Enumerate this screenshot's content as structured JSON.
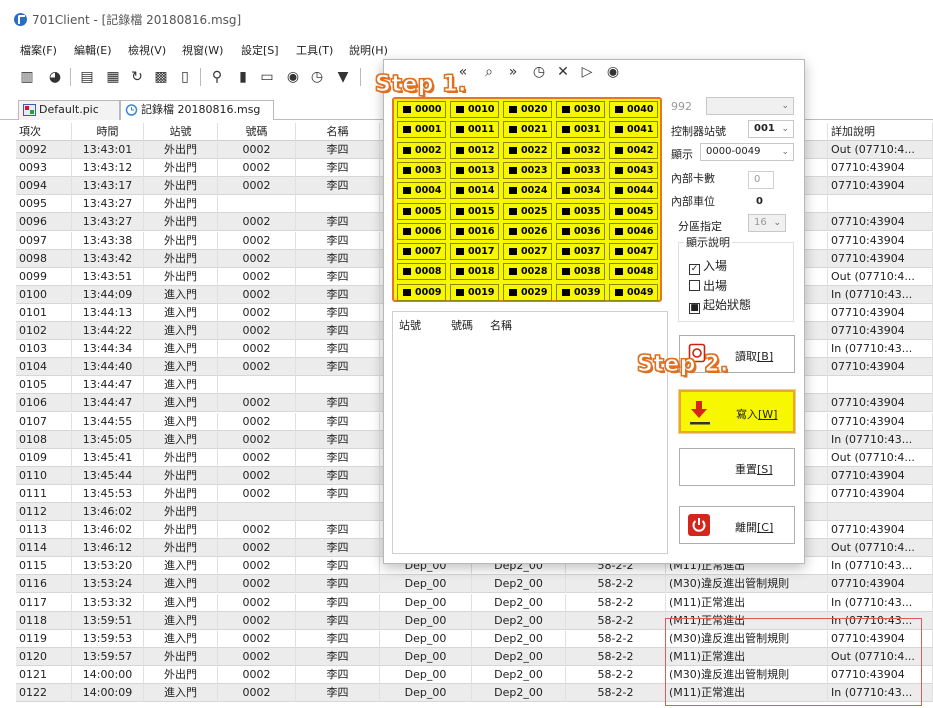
{
  "window": {
    "title": "701Client - [記錄檔 20180816.msg]"
  },
  "menu": [
    "檔案(F)",
    "編輯(E)",
    "檢視(V)",
    "視窗(W)",
    "設定[S]",
    "工具(T)",
    "說明(H)"
  ],
  "toolbar": {
    "icons": [
      "print-icon",
      "preview-icon",
      "edit-icon",
      "calendar-icon",
      "refresh-icon",
      "database-icon",
      "chart-icon",
      "users-icon",
      "card-icon",
      "archive-icon",
      "lock-icon",
      "clock-icon",
      "filter-icon"
    ],
    "dialog_icons": [
      "first-icon",
      "prev-icon",
      "search-icon",
      "next-icon",
      "history-icon",
      "pin-icon",
      "play-icon",
      "stop-icon"
    ],
    "dialog_glyphs": [
      "«",
      "⌕",
      "»",
      "◷",
      "✕",
      "▷",
      "◉"
    ]
  },
  "tabs": [
    {
      "label": "Default.pic"
    },
    {
      "label": "記錄檔 20180816.msg"
    }
  ],
  "grid": {
    "headers": [
      "項次",
      "時間",
      "站號",
      "號碼",
      "名稱",
      "",
      "",
      "",
      "",
      "詳加說明"
    ],
    "rows": [
      [
        "0092",
        "13:43:01",
        "外出門",
        "0002",
        "李四",
        "",
        "",
        "",
        "",
        "Out (07710:4..."
      ],
      [
        "0093",
        "13:43:12",
        "外出門",
        "0002",
        "李四",
        "",
        "",
        "",
        "",
        "07710:43904"
      ],
      [
        "0094",
        "13:43:17",
        "外出門",
        "0002",
        "李四",
        "",
        "",
        "",
        "",
        "07710:43904"
      ],
      [
        "0095",
        "13:43:27",
        "外出門",
        "",
        "",
        "",
        "",
        "",
        "",
        ""
      ],
      [
        "0096",
        "13:43:27",
        "外出門",
        "0002",
        "李四",
        "",
        "",
        "",
        "",
        "07710:43904"
      ],
      [
        "0097",
        "13:43:38",
        "外出門",
        "0002",
        "李四",
        "",
        "",
        "",
        "",
        "07710:43904"
      ],
      [
        "0098",
        "13:43:42",
        "外出門",
        "0002",
        "李四",
        "",
        "",
        "",
        "",
        "07710:43904"
      ],
      [
        "0099",
        "13:43:51",
        "外出門",
        "0002",
        "李四",
        "",
        "",
        "",
        "",
        "Out (07710:4..."
      ],
      [
        "0100",
        "13:44:09",
        "進入門",
        "0002",
        "李四",
        "",
        "",
        "",
        "",
        "In (07710:43..."
      ],
      [
        "0101",
        "13:44:13",
        "進入門",
        "0002",
        "李四",
        "",
        "",
        "",
        "",
        "07710:43904"
      ],
      [
        "0102",
        "13:44:22",
        "進入門",
        "0002",
        "李四",
        "",
        "",
        "",
        "",
        "07710:43904"
      ],
      [
        "0103",
        "13:44:34",
        "進入門",
        "0002",
        "李四",
        "",
        "",
        "",
        "",
        "In (07710:43..."
      ],
      [
        "0104",
        "13:44:40",
        "進入門",
        "0002",
        "李四",
        "",
        "",
        "",
        "",
        "07710:43904"
      ],
      [
        "0105",
        "13:44:47",
        "進入門",
        "",
        "",
        "",
        "",
        "",
        "",
        ""
      ],
      [
        "0106",
        "13:44:47",
        "進入門",
        "0002",
        "李四",
        "",
        "",
        "",
        "",
        "07710:43904"
      ],
      [
        "0107",
        "13:44:55",
        "進入門",
        "0002",
        "李四",
        "",
        "",
        "",
        "",
        "07710:43904"
      ],
      [
        "0108",
        "13:45:05",
        "進入門",
        "0002",
        "李四",
        "",
        "",
        "",
        "",
        "In (07710:43..."
      ],
      [
        "0109",
        "13:45:41",
        "外出門",
        "0002",
        "李四",
        "",
        "",
        "",
        "",
        "Out (07710:4..."
      ],
      [
        "0110",
        "13:45:44",
        "外出門",
        "0002",
        "李四",
        "",
        "",
        "",
        "",
        "07710:43904"
      ],
      [
        "0111",
        "13:45:53",
        "外出門",
        "0002",
        "李四",
        "",
        "",
        "",
        "",
        "07710:43904"
      ],
      [
        "0112",
        "13:46:02",
        "外出門",
        "",
        "",
        "",
        "",
        "",
        "",
        ""
      ],
      [
        "0113",
        "13:46:02",
        "外出門",
        "0002",
        "李四",
        "",
        "",
        "",
        "",
        "07710:43904"
      ],
      [
        "0114",
        "13:46:12",
        "外出門",
        "0002",
        "李四",
        "",
        "",
        "",
        "",
        "Out (07710:4..."
      ],
      [
        "0115",
        "13:53:20",
        "進入門",
        "0002",
        "李四",
        "Dep_00",
        "Dep2_00",
        "58-2-2",
        "(M11)正常進出",
        "In (07710:43..."
      ],
      [
        "0116",
        "13:53:24",
        "進入門",
        "0002",
        "李四",
        "Dep_00",
        "Dep2_00",
        "58-2-2",
        "(M30)違反進出管制規則",
        "07710:43904"
      ],
      [
        "0117",
        "13:53:32",
        "進入門",
        "0002",
        "李四",
        "Dep_00",
        "Dep2_00",
        "58-2-2",
        "(M11)正常進出",
        "In (07710:43..."
      ],
      [
        "0118",
        "13:59:51",
        "進入門",
        "0002",
        "李四",
        "Dep_00",
        "Dep2_00",
        "58-2-2",
        "(M11)正常進出",
        "In (07710:43..."
      ],
      [
        "0119",
        "13:59:53",
        "進入門",
        "0002",
        "李四",
        "Dep_00",
        "Dep2_00",
        "58-2-2",
        "(M30)違反進出管制規則",
        "07710:43904"
      ],
      [
        "0120",
        "13:59:57",
        "外出門",
        "0002",
        "李四",
        "Dep_00",
        "Dep2_00",
        "58-2-2",
        "(M11)正常進出",
        "Out (07710:4..."
      ],
      [
        "0121",
        "14:00:00",
        "外出門",
        "0002",
        "李四",
        "Dep_00",
        "Dep2_00",
        "58-2-2",
        "(M30)違反進出管制規則",
        "07710:43904"
      ],
      [
        "0122",
        "14:00:09",
        "進入門",
        "0002",
        "李四",
        "Dep_00",
        "Dep2_00",
        "58-2-2",
        "(M11)正常進出",
        "In (07710:43..."
      ]
    ]
  },
  "dialog": {
    "io_points": [
      [
        "0000",
        "0010",
        "0020",
        "0030",
        "0040"
      ],
      [
        "0001",
        "0011",
        "0021",
        "0031",
        "0041"
      ],
      [
        "0002",
        "0012",
        "0022",
        "0032",
        "0042"
      ],
      [
        "0003",
        "0013",
        "0023",
        "0033",
        "0043"
      ],
      [
        "0004",
        "0014",
        "0024",
        "0034",
        "0044"
      ],
      [
        "0005",
        "0015",
        "0025",
        "0035",
        "0045"
      ],
      [
        "0006",
        "0016",
        "0026",
        "0036",
        "0046"
      ],
      [
        "0007",
        "0017",
        "0027",
        "0037",
        "0047"
      ],
      [
        "0008",
        "0018",
        "0028",
        "0038",
        "0048"
      ],
      [
        "0009",
        "0019",
        "0029",
        "0039",
        "0049"
      ]
    ],
    "list_headers": [
      "站號",
      "號碼",
      "名稱"
    ],
    "field_992": "992",
    "controller_label": "控制器站號",
    "controller_value": "001",
    "display_label": "顯示",
    "display_value": "0000-0049",
    "card_count_label": "內部卡數",
    "card_count_value": "0",
    "car_slot_label": "內部車位",
    "car_slot_value": "0",
    "zone_label": "分區指定",
    "zone_value": "16",
    "legend_title": "顯示說明",
    "legend_in": "入場",
    "legend_out": "出場",
    "legend_start": "起始狀態",
    "btn_read": "讀取",
    "btn_read_key": "[B]",
    "btn_write": "寫入",
    "btn_write_key": "[W]",
    "btn_reset": "重置",
    "btn_reset_key": "[S]",
    "btn_exit": "離開",
    "btn_exit_key": "[C]"
  },
  "annotations": {
    "step1": "Step 1.",
    "step2": "Step 2."
  },
  "colors": {
    "highlight_yellow": "#f7f700",
    "annotation_orange": "#e07020",
    "row_alt": "#ececec",
    "red_box": "#e05a5a"
  }
}
